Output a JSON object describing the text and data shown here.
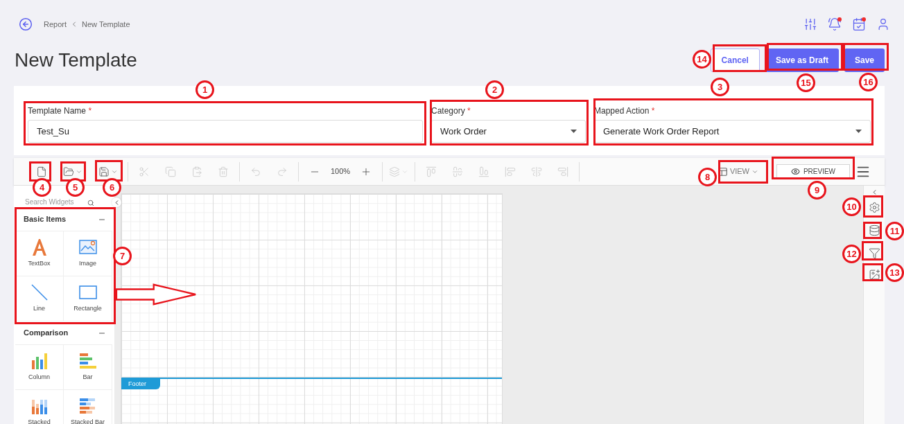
{
  "breadcrumb": [
    {
      "label": "Report"
    },
    {
      "label": "New Template"
    }
  ],
  "title": "New Template",
  "actions": [
    {
      "label": "Cancel",
      "kind": "secondary"
    },
    {
      "label": "Save as Draft",
      "kind": "primary"
    },
    {
      "label": "Save",
      "kind": "primary"
    }
  ],
  "fields": [
    {
      "label": "Template Name",
      "required_mark": "*",
      "kind": "text",
      "value": "Test_Su"
    },
    {
      "label": "Category",
      "required_mark": "*",
      "kind": "select",
      "value": "Work Order"
    },
    {
      "label": "Mapped Action",
      "required_mark": "*",
      "kind": "select",
      "value": "Generate Work Order Report"
    }
  ],
  "toolbar": {
    "zoom": "100%",
    "view": "VIEW",
    "preview": "PREVIEW"
  },
  "widget_search": {
    "placeholder": "Search Widgets"
  },
  "widget_groups": [
    {
      "title": "Basic Items",
      "items": [
        {
          "label": "TextBox",
          "kind": "textbox"
        },
        {
          "label": "Image",
          "kind": "image"
        },
        {
          "label": "Line",
          "kind": "line"
        },
        {
          "label": "Rectangle",
          "kind": "rectangle"
        }
      ]
    },
    {
      "title": "Comparison",
      "items": [
        {
          "label": "Column",
          "kind": "column"
        },
        {
          "label": "Bar",
          "kind": "bar"
        },
        {
          "label": "Stacked",
          "kind": "stacked_column"
        },
        {
          "label": "Stacked Bar",
          "kind": "stacked_bar"
        }
      ]
    }
  ],
  "canvas": {
    "band": "Footer"
  },
  "annotations": [
    {
      "label": "1"
    },
    {
      "label": "2"
    },
    {
      "label": "3"
    },
    {
      "label": "14"
    },
    {
      "label": "15"
    },
    {
      "label": "16"
    },
    {
      "label": "4"
    },
    {
      "label": "5"
    },
    {
      "label": "6"
    },
    {
      "label": "7"
    },
    {
      "label": "8"
    },
    {
      "label": "9"
    },
    {
      "label": "10"
    },
    {
      "label": "11"
    },
    {
      "label": "12"
    },
    {
      "label": "13"
    }
  ]
}
